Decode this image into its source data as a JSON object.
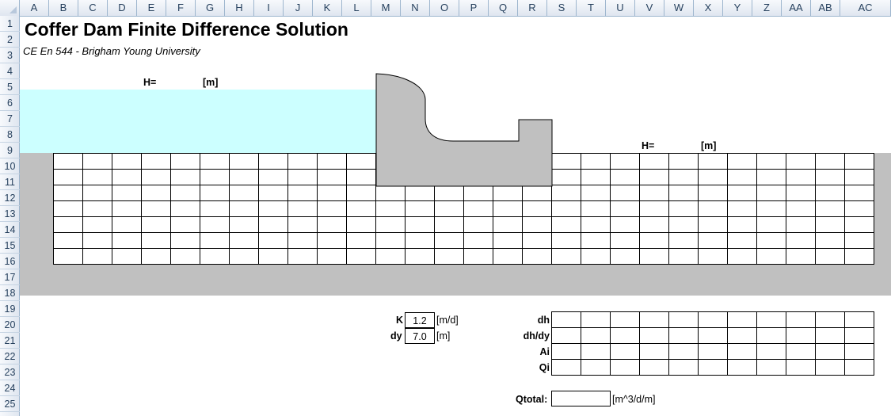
{
  "columns": [
    "A",
    "B",
    "C",
    "D",
    "E",
    "F",
    "G",
    "H",
    "I",
    "J",
    "K",
    "L",
    "M",
    "N",
    "O",
    "P",
    "Q",
    "R",
    "S",
    "T",
    "U",
    "V",
    "W",
    "X",
    "Y",
    "Z",
    "AA",
    "AB",
    "AC"
  ],
  "rows": [
    "1",
    "2",
    "3",
    "4",
    "5",
    "6",
    "7",
    "8",
    "9",
    "10",
    "11",
    "12",
    "13",
    "14",
    "15",
    "16",
    "17",
    "18",
    "19",
    "20",
    "21",
    "22",
    "23",
    "24",
    "25"
  ],
  "sheet": {
    "title": "Coffer Dam Finite Difference Solution",
    "subtitle": "CE En 544 - Brigham Young University"
  },
  "upstream": {
    "h_label": "H=",
    "unit": "[m]"
  },
  "downstream": {
    "h_label": "H=",
    "unit": "[m]"
  },
  "parameters": {
    "k_label": "K",
    "k_value": "1.2",
    "k_unit": "[m/d]",
    "dy_label": "dy",
    "dy_value": "7.0",
    "dy_unit": "[m]"
  },
  "results": {
    "dh_label": "dh",
    "dhdy_label": "dh/dy",
    "ai_label": "Ai",
    "qi_label": "Qi",
    "qtotal_label": "Qtotal:",
    "qtotal_unit": "[m^3/d/m]"
  },
  "colors": {
    "water": "#ccffff",
    "soil": "#c0c0c0",
    "dam": "#c0c0c0",
    "header": "#dfe6f0"
  }
}
